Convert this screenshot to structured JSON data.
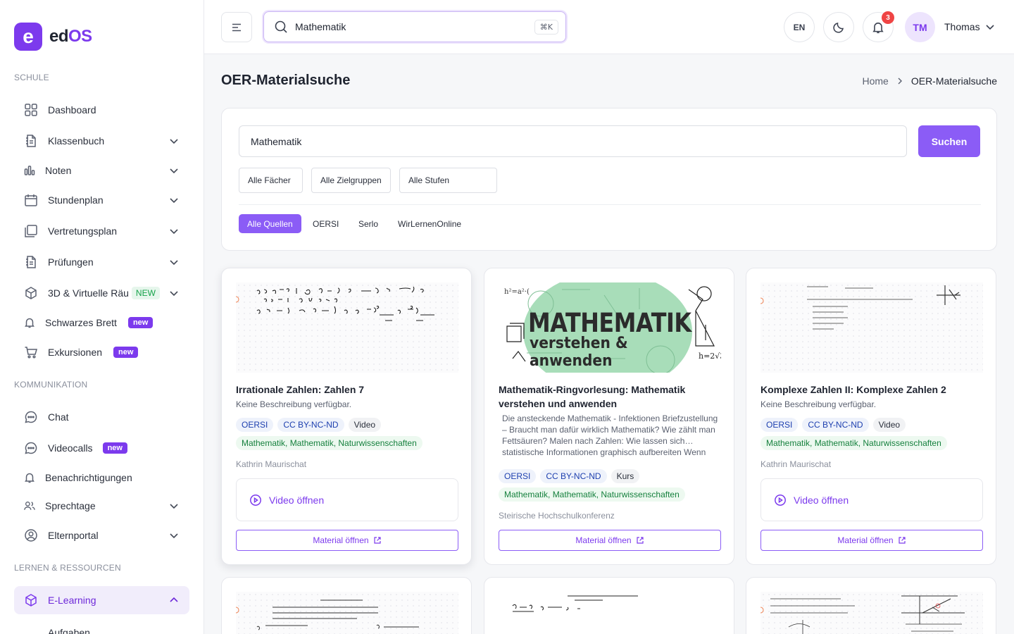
{
  "app": {
    "logo_letter": "e",
    "logo_text_a": "ed",
    "logo_text_b": "OS"
  },
  "sidebar": {
    "sections": {
      "schule": "SCHULE",
      "kommunikation": "KOMMUNIKATION",
      "lernen": "LERNEN & RESSOURCEN"
    },
    "items": {
      "dashboard": "Dashboard",
      "klassenbuch": "Klassenbuch",
      "noten": "Noten",
      "stundenplan": "Stundenplan",
      "vertretungsplan": "Vertretungsplan",
      "pruefungen": "Prüfungen",
      "virtuell": "3D & Virtuelle Räu",
      "virtuell_badge": "NEW",
      "schwarzes_brett": "Schwarzes Brett",
      "schwarzes_brett_badge": "new",
      "exkursionen": "Exkursionen",
      "exkursionen_badge": "new",
      "chat": "Chat",
      "videocalls": "Videocalls",
      "videocalls_badge": "new",
      "benachrichtigungen": "Benachrichtigungen",
      "sprechtage": "Sprechtage",
      "elternportal": "Elternportal",
      "elearning": "E-Learning",
      "aufgaben": "Aufgaben"
    }
  },
  "header": {
    "search_value": "Mathematik",
    "shortcut": "⌘K",
    "language": "EN",
    "notification_count": "3",
    "avatar_initials": "TM",
    "user_name": "Thomas"
  },
  "page": {
    "title": "OER-Materialsuche",
    "breadcrumb": {
      "home": "Home",
      "current": "OER-Materialsuche"
    }
  },
  "search_panel": {
    "query": "Mathematik",
    "button": "Suchen",
    "filters": [
      "Alle Fächer",
      "Alle Zielgruppen",
      "Alle Stufen"
    ],
    "sources": [
      "Alle Quellen",
      "OERSI",
      "Serlo",
      "WirLernenOnline"
    ]
  },
  "cards": [
    {
      "title": "Irrationale Zahlen: Zahlen 7",
      "description": "Keine Beschreibung verfügbar.",
      "tags": [
        "OERSI",
        "CC BY-NC-ND",
        "Video"
      ],
      "subjects": "Mathematik, Mathematik, Naturwissenschaften",
      "author": "Kathrin Maurischat",
      "video_label": "Video öffnen",
      "material_label": "Material öffnen"
    },
    {
      "title": "Mathematik-Ringvorlesung: Mathematik verstehen und anwenden",
      "description": "Die ansteckende Mathematik - Infektionen Briefzustellung – Braucht man dafür wirklich Mathematik? Wie zählt man Fettsäuren? Malen nach Zahlen: Wie lassen sich… statistische Informationen graphisch aufbereiten Wenn",
      "tags": [
        "OERSI",
        "CC BY-NC-ND",
        "Kurs"
      ],
      "subjects": "Mathematik, Mathematik, Naturwissenschaften",
      "author": "Steirische Hochschulkonferenz",
      "material_label": "Material öffnen",
      "thumb_title": "MATHEMATIK",
      "thumb_subtitle": "verstehen & anwenden"
    },
    {
      "title": "Komplexe Zahlen II: Komplexe Zahlen 2",
      "description": "Keine Beschreibung verfügbar.",
      "tags": [
        "OERSI",
        "CC BY-NC-ND",
        "Video"
      ],
      "subjects": "Mathematik, Mathematik, Naturwissenschaften",
      "author": "Kathrin Maurischat",
      "video_label": "Video öffnen",
      "material_label": "Material öffnen"
    }
  ],
  "colors": {
    "accent": "#7c3aed",
    "accent_light": "#8b5cf6",
    "badge_red": "#ef4444"
  }
}
